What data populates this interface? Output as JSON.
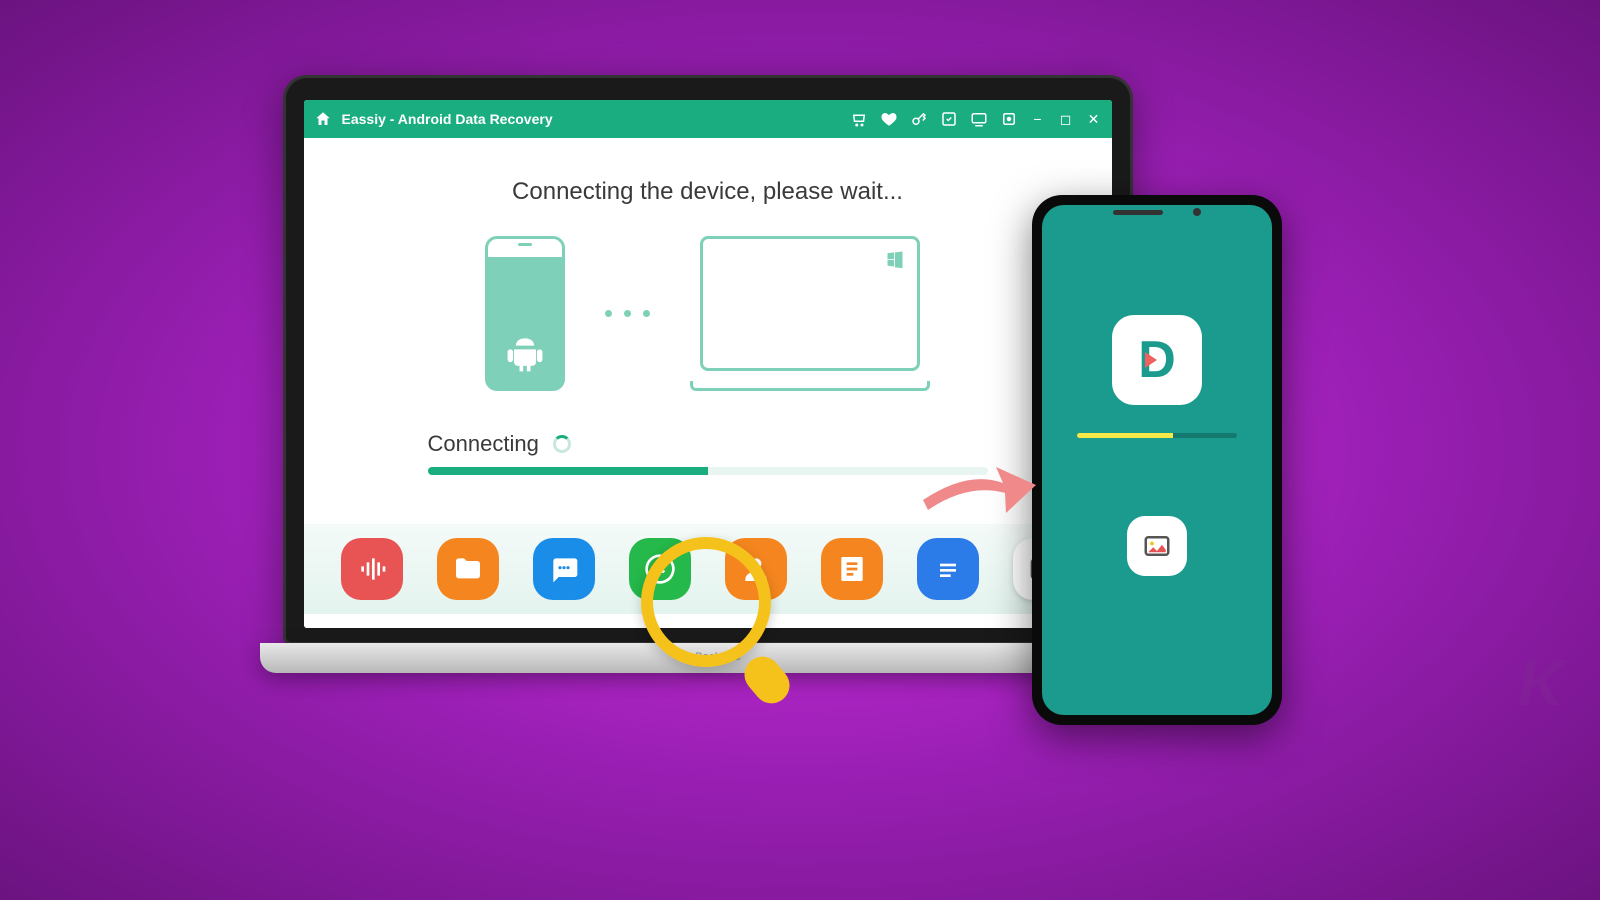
{
  "titlebar": {
    "app_title": "Eassiy - Android Data Recovery",
    "icons": [
      "cart",
      "heart",
      "key",
      "register",
      "feedback",
      "update",
      "minimize",
      "maximize",
      "close"
    ]
  },
  "content": {
    "headline": "Connecting the device, please wait...",
    "progress_label": "Connecting",
    "progress_percent": 50
  },
  "dock": {
    "items": [
      {
        "name": "audio",
        "color": "red"
      },
      {
        "name": "files",
        "color": "orange"
      },
      {
        "name": "messages",
        "color": "blue"
      },
      {
        "name": "whatsapp",
        "color": "green"
      },
      {
        "name": "contacts",
        "color": "orange"
      },
      {
        "name": "notes",
        "color": "orange"
      },
      {
        "name": "documents",
        "color": "blue"
      },
      {
        "name": "photos",
        "color": "white"
      }
    ]
  },
  "laptop": {
    "model_label": "MacBook Pro"
  },
  "phone": {
    "progress_percent": 60,
    "progress_label": ""
  },
  "watermark": "K"
}
